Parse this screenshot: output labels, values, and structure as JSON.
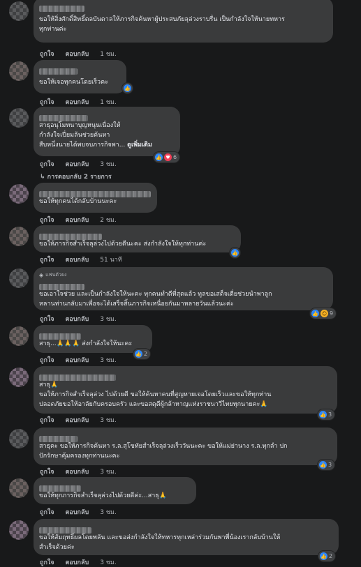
{
  "actions": {
    "like": "ถูกใจ",
    "reply": "ตอบกลับ"
  },
  "comments": [
    {
      "badge": "",
      "text": "ขอให้สิ่งศักดิ์สิทธิ์ดลบันดาลให้ภารกิจค้นหาผู้ประสบภัยลุล่วงราบรื่น เป็นกำลังใจให้นายทหาร\nทุกท่านค่ะ",
      "time": "1 ชม.",
      "reactions": ""
    },
    {
      "badge": "",
      "text": "ขอให้เจอทุกคนโดยเร็วคะ",
      "time": "1 ชม.",
      "reactions": ""
    },
    {
      "badge": "",
      "text": "สาธุอนุโมทนาบุญหนุนเนื่องให้\nกำลังใจเปี่ยมล้นช่วยค้นหา\nสืบหนึ่งนายได้พบจบภารกิจพา...",
      "see_more": "ดูเพิ่มเติม",
      "time": "3 ชม.",
      "reactions": "6"
    },
    {
      "badge": "",
      "text": "ขอให้ทุกคนได้กลับบ้านนะคะ",
      "time": "2 ชม.",
      "reactions": ""
    },
    {
      "badge": "",
      "text": "ขอให้ภารกิจสำเร็จลุล่วงไปด้วยดีนะคะ ส่งกำลังใจให้ทุกท่านค่ะ",
      "time": "51 นาที",
      "reactions": ""
    },
    {
      "badge": "แฟนตัวยง",
      "text": "ขอเอาใจช่วย และเป็นกำลังใจให้นะคะ ทุกคนทำดีที่สุดแล้ว ทูลขอเสด็จเตี่ยช่วยนำพาลูก\nหลานท่านกลับมาเพื่อจะได้เสร็จสิ้นภารกิจเหนื่อยกันมาหลายวันแล้วนะค่ะ",
      "time": "3 ชม.",
      "reactions": "9"
    },
    {
      "badge": "",
      "text": "สาธุ...🙏🙏🙏 ส่งกำลังใจให้นะคะ",
      "time": "3 ชม.",
      "reactions": "2"
    },
    {
      "badge": "",
      "text": "สาธุ🙏\nขอให้ภารกิจสำเร็จลุล่วง ไปด้วยดี ขอให้ค้นหาคนที่สูญหายเจอโดยเร็วและขอให้ทุกท่าน\nปลอดภัยขอให้อาลัยกับครอบครัว และขอสดุดีผู้กล้าหาญแห่งราชนาวีไทยทุกนายคะ🙏",
      "time": "3 ชม.",
      "reactions": "3"
    },
    {
      "badge": "",
      "text": "สาธุคะ ขอให้ภารกิจค้นหา ร.ล.สุโขทัยสำเร็จลุล่วงเร็ววันนะคะ ขอให้แม่ย่านาง ร.ล.ทุกลำ ปก\nปักรักษาคุ้มครองทุกท่านนะคะ",
      "time": "3 ชม.",
      "reactions": "3"
    },
    {
      "badge": "",
      "text": "ขอให้ทุกภารกิจสำเร็จลุล่วงไปด้วยดีค่ะ...สาธุ🙏",
      "time": "3 ชม.",
      "reactions": ""
    },
    {
      "badge": "",
      "text": "ขอให้สัมฤทธิ์ผลโดยพลัน และขอส่งกำลังใจให้ทหารทุกเหล่าร่วมกันพาพี่น้องเรากลับบ้านให้\nสำเร็จด้วยค่ะ",
      "time": "3 ชม.",
      "reactions": "2"
    }
  ],
  "replies_link": "↳ การตอบกลับ 2 รายการ",
  "icons": {
    "like": "like-reaction-icon",
    "love": "love-reaction-icon",
    "haha": "haha-reaction-icon",
    "badge": "fan-badge-icon"
  }
}
